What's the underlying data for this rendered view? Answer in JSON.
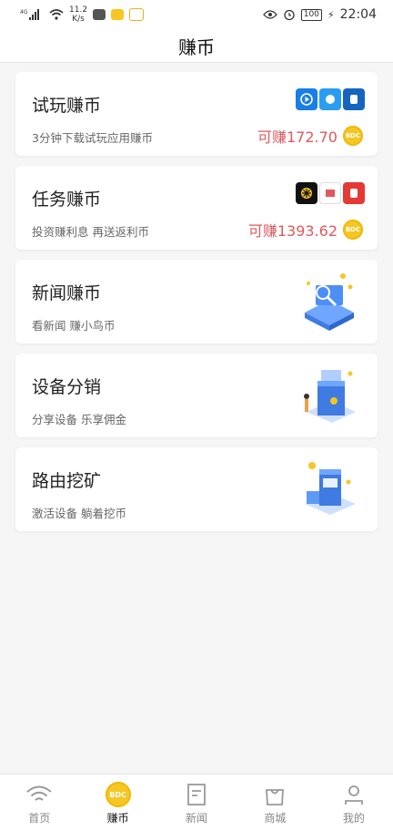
{
  "status_bar": {
    "signal": "4G",
    "net_speed": "11.2",
    "net_unit": "K/s",
    "battery": "100",
    "time": "22:04"
  },
  "header": {
    "title": "赚币"
  },
  "cards": [
    {
      "title": "试玩赚币",
      "subtitle": "3分钟下载试玩应用赚币",
      "earn": "可赚172.70",
      "coin": "BDC"
    },
    {
      "title": "任务赚币",
      "subtitle": "投资赚利息 再送返利币",
      "earn": "可赚1393.62",
      "coin": "BDC"
    },
    {
      "title": "新闻赚币",
      "subtitle": "看新闻 赚小鸟币"
    },
    {
      "title": "设备分销",
      "subtitle": "分享设备 乐享佣金"
    },
    {
      "title": "路由挖矿",
      "subtitle": "激活设备 躺着挖币"
    }
  ],
  "tabbar": {
    "items": [
      {
        "label": "首页",
        "icon": "wifi-icon"
      },
      {
        "label": "赚币",
        "icon": "bdc-coin-icon",
        "coin_text": "BDC",
        "active": true
      },
      {
        "label": "新闻",
        "icon": "news-icon"
      },
      {
        "label": "商城",
        "icon": "shopping-bag-icon"
      },
      {
        "label": "我的",
        "icon": "profile-icon"
      }
    ]
  },
  "colors": {
    "accent": "#f6c623",
    "earn": "#e0595c"
  }
}
